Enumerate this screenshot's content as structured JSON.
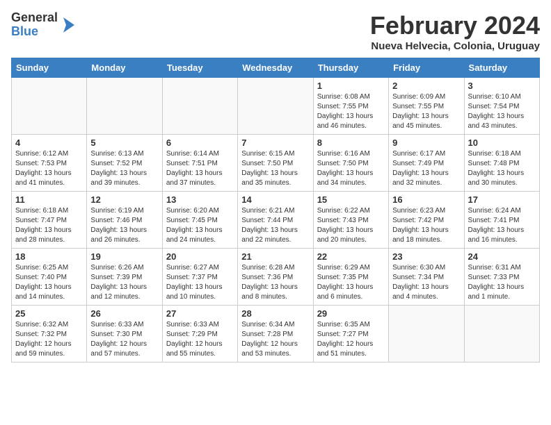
{
  "logo": {
    "text_general": "General",
    "text_blue": "Blue"
  },
  "title": "February 2024",
  "subtitle": "Nueva Helvecia, Colonia, Uruguay",
  "days_of_week": [
    "Sunday",
    "Monday",
    "Tuesday",
    "Wednesday",
    "Thursday",
    "Friday",
    "Saturday"
  ],
  "weeks": [
    [
      {
        "day": "",
        "info": ""
      },
      {
        "day": "",
        "info": ""
      },
      {
        "day": "",
        "info": ""
      },
      {
        "day": "",
        "info": ""
      },
      {
        "day": "1",
        "info": "Sunrise: 6:08 AM\nSunset: 7:55 PM\nDaylight: 13 hours and 46 minutes."
      },
      {
        "day": "2",
        "info": "Sunrise: 6:09 AM\nSunset: 7:55 PM\nDaylight: 13 hours and 45 minutes."
      },
      {
        "day": "3",
        "info": "Sunrise: 6:10 AM\nSunset: 7:54 PM\nDaylight: 13 hours and 43 minutes."
      }
    ],
    [
      {
        "day": "4",
        "info": "Sunrise: 6:12 AM\nSunset: 7:53 PM\nDaylight: 13 hours and 41 minutes."
      },
      {
        "day": "5",
        "info": "Sunrise: 6:13 AM\nSunset: 7:52 PM\nDaylight: 13 hours and 39 minutes."
      },
      {
        "day": "6",
        "info": "Sunrise: 6:14 AM\nSunset: 7:51 PM\nDaylight: 13 hours and 37 minutes."
      },
      {
        "day": "7",
        "info": "Sunrise: 6:15 AM\nSunset: 7:50 PM\nDaylight: 13 hours and 35 minutes."
      },
      {
        "day": "8",
        "info": "Sunrise: 6:16 AM\nSunset: 7:50 PM\nDaylight: 13 hours and 34 minutes."
      },
      {
        "day": "9",
        "info": "Sunrise: 6:17 AM\nSunset: 7:49 PM\nDaylight: 13 hours and 32 minutes."
      },
      {
        "day": "10",
        "info": "Sunrise: 6:18 AM\nSunset: 7:48 PM\nDaylight: 13 hours and 30 minutes."
      }
    ],
    [
      {
        "day": "11",
        "info": "Sunrise: 6:18 AM\nSunset: 7:47 PM\nDaylight: 13 hours and 28 minutes."
      },
      {
        "day": "12",
        "info": "Sunrise: 6:19 AM\nSunset: 7:46 PM\nDaylight: 13 hours and 26 minutes."
      },
      {
        "day": "13",
        "info": "Sunrise: 6:20 AM\nSunset: 7:45 PM\nDaylight: 13 hours and 24 minutes."
      },
      {
        "day": "14",
        "info": "Sunrise: 6:21 AM\nSunset: 7:44 PM\nDaylight: 13 hours and 22 minutes."
      },
      {
        "day": "15",
        "info": "Sunrise: 6:22 AM\nSunset: 7:43 PM\nDaylight: 13 hours and 20 minutes."
      },
      {
        "day": "16",
        "info": "Sunrise: 6:23 AM\nSunset: 7:42 PM\nDaylight: 13 hours and 18 minutes."
      },
      {
        "day": "17",
        "info": "Sunrise: 6:24 AM\nSunset: 7:41 PM\nDaylight: 13 hours and 16 minutes."
      }
    ],
    [
      {
        "day": "18",
        "info": "Sunrise: 6:25 AM\nSunset: 7:40 PM\nDaylight: 13 hours and 14 minutes."
      },
      {
        "day": "19",
        "info": "Sunrise: 6:26 AM\nSunset: 7:39 PM\nDaylight: 13 hours and 12 minutes."
      },
      {
        "day": "20",
        "info": "Sunrise: 6:27 AM\nSunset: 7:37 PM\nDaylight: 13 hours and 10 minutes."
      },
      {
        "day": "21",
        "info": "Sunrise: 6:28 AM\nSunset: 7:36 PM\nDaylight: 13 hours and 8 minutes."
      },
      {
        "day": "22",
        "info": "Sunrise: 6:29 AM\nSunset: 7:35 PM\nDaylight: 13 hours and 6 minutes."
      },
      {
        "day": "23",
        "info": "Sunrise: 6:30 AM\nSunset: 7:34 PM\nDaylight: 13 hours and 4 minutes."
      },
      {
        "day": "24",
        "info": "Sunrise: 6:31 AM\nSunset: 7:33 PM\nDaylight: 13 hours and 1 minute."
      }
    ],
    [
      {
        "day": "25",
        "info": "Sunrise: 6:32 AM\nSunset: 7:32 PM\nDaylight: 12 hours and 59 minutes."
      },
      {
        "day": "26",
        "info": "Sunrise: 6:33 AM\nSunset: 7:30 PM\nDaylight: 12 hours and 57 minutes."
      },
      {
        "day": "27",
        "info": "Sunrise: 6:33 AM\nSunset: 7:29 PM\nDaylight: 12 hours and 55 minutes."
      },
      {
        "day": "28",
        "info": "Sunrise: 6:34 AM\nSunset: 7:28 PM\nDaylight: 12 hours and 53 minutes."
      },
      {
        "day": "29",
        "info": "Sunrise: 6:35 AM\nSunset: 7:27 PM\nDaylight: 12 hours and 51 minutes."
      },
      {
        "day": "",
        "info": ""
      },
      {
        "day": "",
        "info": ""
      }
    ]
  ]
}
